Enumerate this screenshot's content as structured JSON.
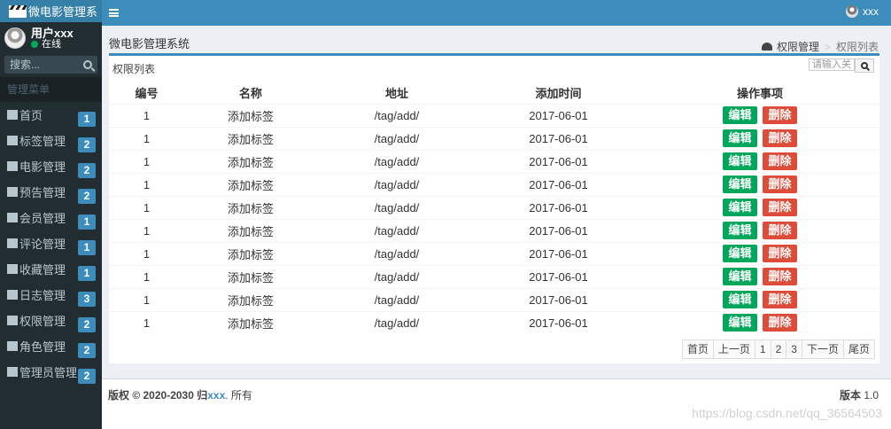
{
  "app": {
    "logo_text": "微电影管理系"
  },
  "user": {
    "name": "用户xxx",
    "status": "在线",
    "top_name": "xxx"
  },
  "sidebar": {
    "search_placeholder": "搜索...",
    "header": "管理菜单",
    "items": [
      {
        "label": "首页",
        "badge": "1",
        "icon": "home-icon"
      },
      {
        "label": "标签管理",
        "badge": "2",
        "icon": "tags-icon"
      },
      {
        "label": "电影管理",
        "badge": "2",
        "icon": "file-video-icon"
      },
      {
        "label": "预告管理",
        "badge": "2",
        "icon": "film-icon"
      },
      {
        "label": "会员管理",
        "badge": "1",
        "icon": "users-icon"
      },
      {
        "label": "评论管理",
        "badge": "1",
        "icon": "comments-icon"
      },
      {
        "label": "收藏管理",
        "badge": "1",
        "icon": "heart-icon"
      },
      {
        "label": "日志管理",
        "badge": "3",
        "icon": "file-text-icon"
      },
      {
        "label": "权限管理",
        "badge": "2",
        "icon": "lock-icon"
      },
      {
        "label": "角色管理",
        "badge": "2",
        "icon": "user-secret-icon"
      },
      {
        "label": "管理员管理",
        "badge": "2",
        "icon": "user-circle-icon"
      }
    ]
  },
  "content": {
    "title": "微电影管理系统",
    "breadcrumb": {
      "parent": "权限管理",
      "current": "权限列表"
    },
    "box_title": "权限列表",
    "search_placeholder": "请输入关键字"
  },
  "table": {
    "headers": [
      "编号",
      "名称",
      "地址",
      "添加时间",
      "操作事项"
    ],
    "edit_label": "编辑",
    "delete_label": "删除",
    "rows": [
      {
        "id": "1",
        "name": "添加标签",
        "url": "/tag/add/",
        "date": "2017-06-01"
      },
      {
        "id": "1",
        "name": "添加标签",
        "url": "/tag/add/",
        "date": "2017-06-01"
      },
      {
        "id": "1",
        "name": "添加标签",
        "url": "/tag/add/",
        "date": "2017-06-01"
      },
      {
        "id": "1",
        "name": "添加标签",
        "url": "/tag/add/",
        "date": "2017-06-01"
      },
      {
        "id": "1",
        "name": "添加标签",
        "url": "/tag/add/",
        "date": "2017-06-01"
      },
      {
        "id": "1",
        "name": "添加标签",
        "url": "/tag/add/",
        "date": "2017-06-01"
      },
      {
        "id": "1",
        "name": "添加标签",
        "url": "/tag/add/",
        "date": "2017-06-01"
      },
      {
        "id": "1",
        "name": "添加标签",
        "url": "/tag/add/",
        "date": "2017-06-01"
      },
      {
        "id": "1",
        "name": "添加标签",
        "url": "/tag/add/",
        "date": "2017-06-01"
      },
      {
        "id": "1",
        "name": "添加标签",
        "url": "/tag/add/",
        "date": "2017-06-01"
      }
    ]
  },
  "pagination": [
    "首页",
    "上一页",
    "1",
    "2",
    "3",
    "下一页",
    "尾页"
  ],
  "footer": {
    "copyright_prefix": "版权 © 2020-2030 归",
    "brand": "xxx",
    "copyright_suffix": ". 所有",
    "version_label": "版本",
    "version": "1.0",
    "watermark": "https://blog.csdn.net/qq_36564503"
  },
  "colors": {
    "sidebar_bg": "#222d32",
    "header_bg": "#3c8dbc",
    "edit_green": "#00a65a",
    "delete_red": "#dd4b39",
    "badge_blue": "#3c8dbc"
  }
}
